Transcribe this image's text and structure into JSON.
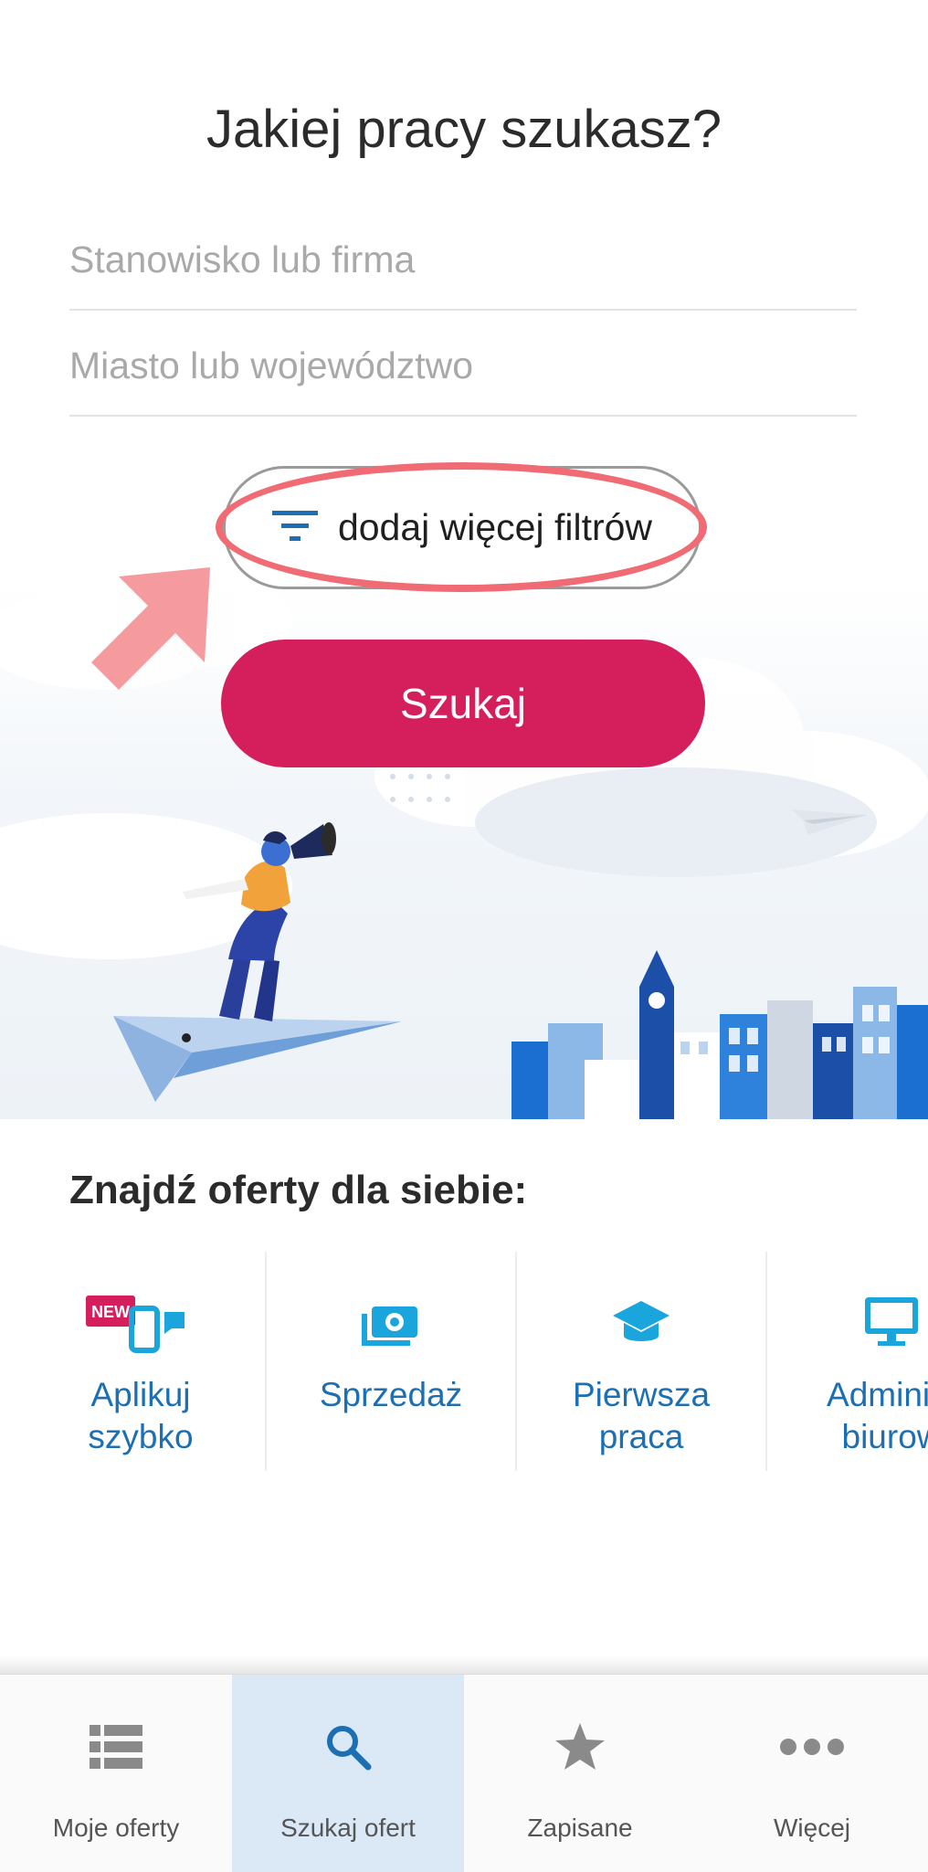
{
  "search": {
    "title": "Jakiej pracy szukasz?",
    "position_placeholder": "Stanowisko lub firma",
    "position_value": "",
    "location_placeholder": "Miasto lub województwo",
    "location_value": "",
    "filters_label": "dodaj więcej filtrów",
    "search_label": "Szukaj"
  },
  "offers": {
    "title": "Znajdź oferty dla siebie:",
    "categories": [
      {
        "label": "Aplikuj\nszybko",
        "badge": "NEW",
        "icon": "quick-apply-icon"
      },
      {
        "label": "Sprzedaż",
        "icon": "money-icon"
      },
      {
        "label": "Pierwsza\npraca",
        "icon": "graduation-cap-icon"
      },
      {
        "label": "Administ\nbiurow",
        "icon": "monitor-icon"
      }
    ]
  },
  "nav": {
    "items": [
      {
        "label": "Moje oferty",
        "icon": "list-icon",
        "active": false
      },
      {
        "label": "Szukaj ofert",
        "icon": "search-icon",
        "active": true
      },
      {
        "label": "Zapisane",
        "icon": "star-icon",
        "active": false
      },
      {
        "label": "Więcej",
        "icon": "more-dots-icon",
        "active": false
      }
    ]
  },
  "colors": {
    "accent": "#d41f5c",
    "link": "#1c6fb2",
    "highlight": "#f06b73",
    "nav_active_bg": "#dbe9f7"
  }
}
